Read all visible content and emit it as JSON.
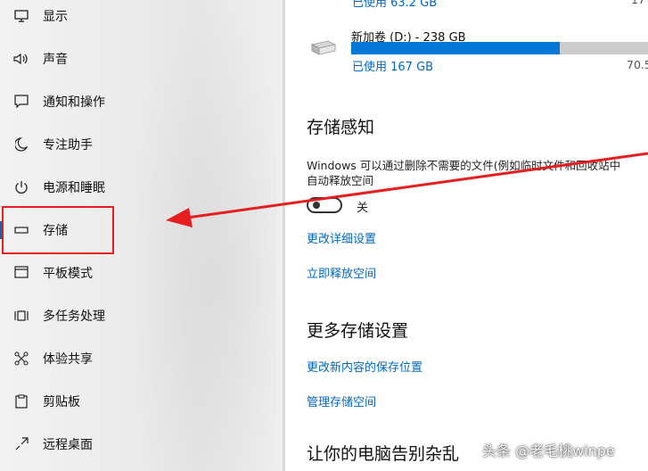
{
  "sidebar": {
    "items": [
      {
        "label": "显示",
        "icon": "monitor-icon"
      },
      {
        "label": "声音",
        "icon": "speaker-icon"
      },
      {
        "label": "通知和操作",
        "icon": "notification-icon"
      },
      {
        "label": "专注助手",
        "icon": "moon-icon"
      },
      {
        "label": "电源和睡眠",
        "icon": "power-icon"
      },
      {
        "label": "存储",
        "icon": "storage-drive-icon",
        "selected": true
      },
      {
        "label": "平板模式",
        "icon": "tablet-mode-icon"
      },
      {
        "label": "多任务处理",
        "icon": "multitasking-icon"
      },
      {
        "label": "体验共享",
        "icon": "shared-experience-icon"
      },
      {
        "label": "剪贴板",
        "icon": "clipboard-icon"
      },
      {
        "label": "远程桌面",
        "icon": "remote-desktop-icon"
      }
    ]
  },
  "drives": {
    "c_used_partial": "已使用 63.2 GB",
    "c_right_partial": "17",
    "d_name": "新加卷 (D:) - 238 GB",
    "d_used": "已使用 167 GB",
    "d_free_partial": "70.5",
    "d_used_fraction": 0.702
  },
  "storage_sense": {
    "title": "存储感知",
    "description_line1": "Windows 可以通过删除不需要的文件(例如临时文件和回收站中",
    "description_line2": "自动释放空间",
    "toggle_state": "关",
    "link_change_settings": "更改详细设置",
    "link_free_now": "立即释放空间"
  },
  "more_storage": {
    "title": "更多存储设置",
    "link_change_save_location": "更改新内容的保存位置",
    "link_manage_spaces": "管理存储空间"
  },
  "bottom_heading": "让你的电脑告别杂乱",
  "watermark": "头条 @老毛桃winpe",
  "colors": {
    "accent": "#0078d7",
    "link": "#0067c0",
    "annotation": "#e51f1f"
  }
}
